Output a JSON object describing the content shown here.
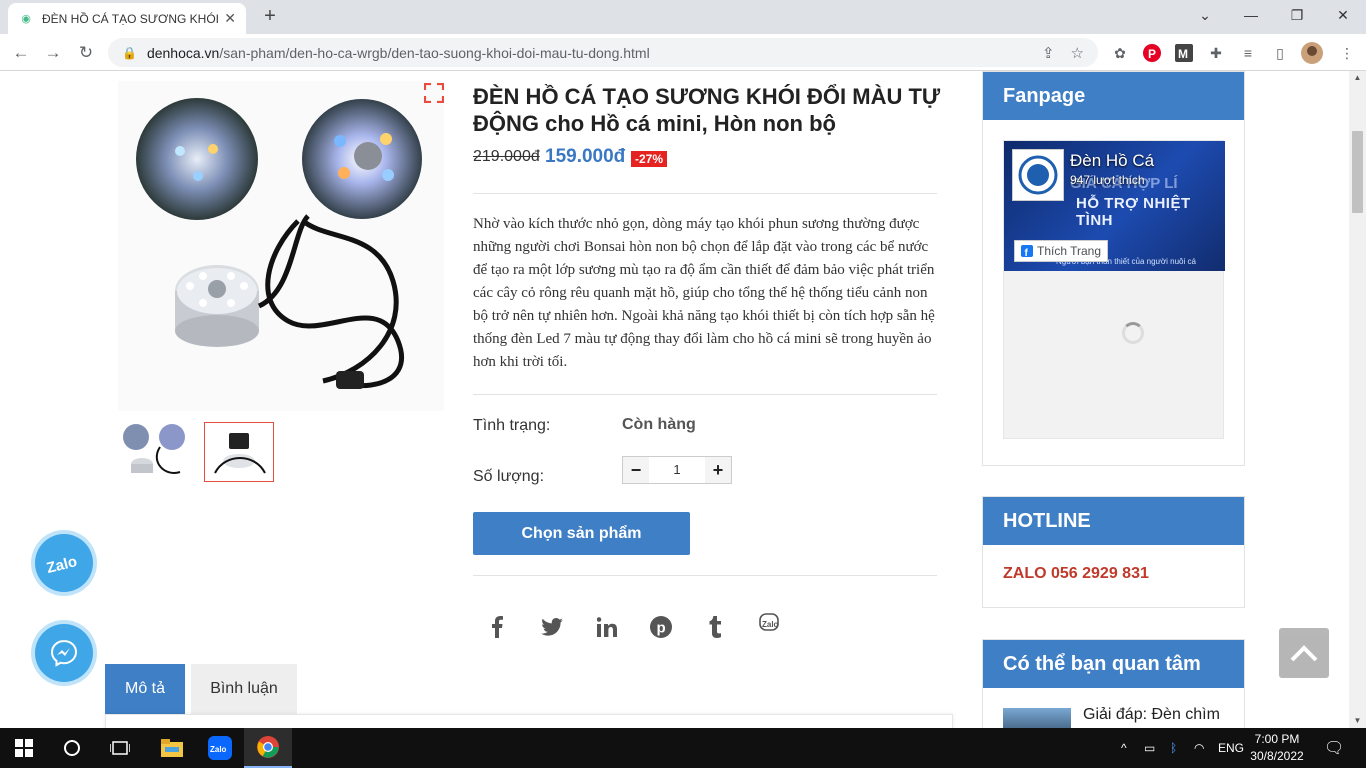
{
  "browser": {
    "tab_title": "ĐÈN HỒ CÁ TẠO SƯƠNG KHÓI Đ",
    "url_host": "denhoca.vn",
    "url_path": "/san-pham/den-ho-ca-wrgb/den-tao-suong-khoi-doi-mau-tu-dong.html"
  },
  "product": {
    "title": "ĐÈN HỒ CÁ TẠO SƯƠNG KHÓI ĐỔI MÀU TỰ ĐỘNG cho Hồ cá mini, Hòn non bộ",
    "old_price": "219.000đ",
    "new_price": "159.000đ",
    "discount": "-27%",
    "description": "Nhờ vào kích thước nhỏ gọn, dòng máy tạo khói phun sương thường được những người chơi Bonsai hòn non bộ chọn để lắp đặt vào trong các bể nước để tạo ra một lớp sương mù tạo ra độ ẩm cần thiết để đảm bảo việc phát triển các cây cỏ rông rêu quanh mặt hồ, giúp cho tổng thể hệ thống tiểu cảnh non bộ trở nên tự nhiên hơn. Ngoài khả năng tạo khói thiết bị còn tích hợp sẵn hệ thống đèn Led 7 màu tự động thay đổi làm cho hồ cá mini sẽ trong huyền ảo hơn khi trời tối.",
    "status_label": "Tình trạng:",
    "status_value": "Còn hàng",
    "quantity_label": "Số lượng:",
    "quantity_value": "1",
    "minus": "−",
    "plus": "+",
    "buy_button": "Chọn sản phẩm"
  },
  "tabs": {
    "description": "Mô tả",
    "comments": "Bình luận"
  },
  "sidebar": {
    "fanpage": {
      "heading": "Fanpage",
      "page_name": "Đèn Hồ Cá",
      "likes": "947 lượt thích",
      "like_button": "Thích Trang"
    },
    "hotline": {
      "heading": "HOTLINE",
      "text": "ZALO 056 2929 831"
    },
    "related": {
      "heading": "Có thể bạn quan tâm",
      "first_item": "Giải đáp: Đèn chìm"
    }
  },
  "taskbar": {
    "language": "ENG",
    "time": "7:00 PM",
    "date": "30/8/2022"
  },
  "icons": [
    "favicon-icon",
    "close-icon",
    "plus-icon",
    "back-icon",
    "forward-icon",
    "reload-icon",
    "lock-icon",
    "share-icon",
    "star-icon",
    "extension-icon",
    "pinterest-icon",
    "puzzle-icon",
    "sidebar-icon",
    "profile-avatar",
    "expand-icon",
    "facebook-icon",
    "twitter-icon",
    "linkedin-icon",
    "pinterest-icon",
    "tumblr-icon",
    "zalo-icon",
    "messenger-icon",
    "chevron-up-icon",
    "windows-icon",
    "search-icon",
    "task-view-icon",
    "file-explorer-icon",
    "chrome-icon"
  ],
  "colors": {
    "accent": "#3f7fc5",
    "sale_red": "#e52421",
    "hotline_red": "#c0392b",
    "price_blue": "#3a78c3"
  }
}
